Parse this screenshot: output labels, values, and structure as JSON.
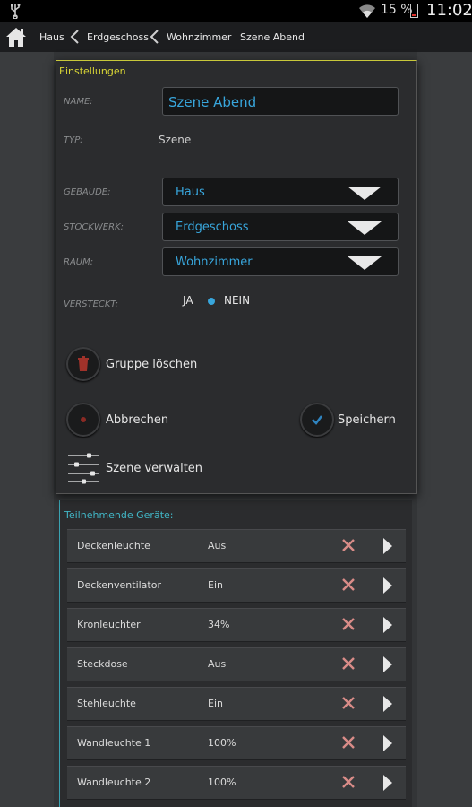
{
  "status": {
    "battery_pct": "15 %",
    "time": "11:02",
    "battery_level": 0.15
  },
  "breadcrumb": [
    "Haus",
    "Erdgeschoss",
    "Wohnzimmer",
    "Szene Abend"
  ],
  "dialog": {
    "title": "Einstellungen",
    "name_label": "NAME:",
    "name_value": "Szene Abend",
    "type_label": "TYP:",
    "type_value": "Szene",
    "building_label": "GEBÄUDE:",
    "building_value": "Haus",
    "floor_label": "STOCKWERK:",
    "floor_value": "Erdgeschoss",
    "room_label": "RAUM:",
    "room_value": "Wohnzimmer",
    "hidden_label": "VERSTECKT:",
    "hidden_yes": "JA",
    "hidden_no": "NEIN",
    "hidden_selected": "NEIN",
    "delete_group": "Gruppe löschen",
    "cancel": "Abbrechen",
    "save": "Speichern",
    "manage_scene": "Szene verwalten"
  },
  "devices": {
    "title": "Teilnehmende Geräte:",
    "rows": [
      {
        "name": "Deckenleuchte",
        "state": "Aus"
      },
      {
        "name": "Deckenventilator",
        "state": "Ein"
      },
      {
        "name": "Kronleuchter",
        "state": "34%"
      },
      {
        "name": "Steckdose",
        "state": "Aus"
      },
      {
        "name": "Stehleuchte",
        "state": "Ein"
      },
      {
        "name": "Wandleuchte 1",
        "state": "100%"
      },
      {
        "name": "Wandleuchte 2",
        "state": "100%"
      }
    ]
  },
  "colors": {
    "accent": "#38a6dc",
    "title_yellow": "#d7d435",
    "list_teal": "#41b6c6",
    "delete_red": "#c0392b"
  }
}
